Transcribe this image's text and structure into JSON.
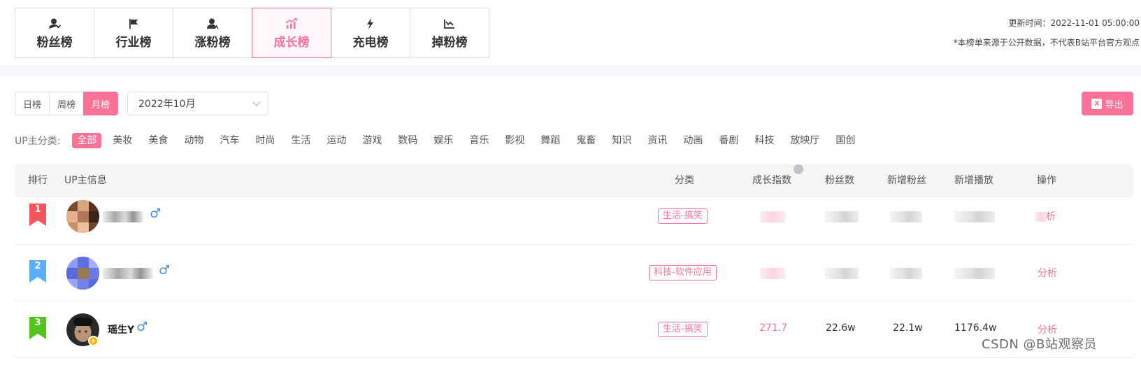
{
  "tabs": [
    {
      "label": "粉丝榜",
      "icon": "fans-icon",
      "active": false
    },
    {
      "label": "行业榜",
      "icon": "flag-icon",
      "active": false
    },
    {
      "label": "涨粉榜",
      "icon": "user-up-icon",
      "active": false
    },
    {
      "label": "成长榜",
      "icon": "growth-chart-icon",
      "active": true
    },
    {
      "label": "充电榜",
      "icon": "lightning-icon",
      "active": false
    },
    {
      "label": "掉粉榜",
      "icon": "down-chart-icon",
      "active": false
    }
  ],
  "header": {
    "update_time": "更新时间：2022-11-01 05:00:00",
    "disclaimer": "*本榜单来源于公开数据，不代表B站平台官方观点"
  },
  "period": {
    "buttons": [
      "日榜",
      "周榜",
      "月榜"
    ],
    "active": "月榜",
    "month_value": "2022年10月"
  },
  "export_label": "导出",
  "categories": {
    "label": "UP主分类:",
    "items": [
      "全部",
      "美妆",
      "美食",
      "动物",
      "汽车",
      "时尚",
      "生活",
      "运动",
      "游戏",
      "数码",
      "娱乐",
      "音乐",
      "影视",
      "舞蹈",
      "鬼畜",
      "知识",
      "资讯",
      "动画",
      "番剧",
      "科技",
      "放映厅",
      "国创"
    ],
    "active": "全部"
  },
  "table": {
    "headers": {
      "rank": "排行",
      "info": "UP主信息",
      "category": "分类",
      "growth": "成长指数",
      "fans": "粉丝数",
      "new_fans": "新增粉丝",
      "new_plays": "新增播放",
      "action": "操作"
    },
    "rows": [
      {
        "rank": "1",
        "rank_color": "#f5555b",
        "name": "",
        "gender": "♂",
        "category": "生活-搞笑",
        "growth": "",
        "fans": "",
        "new_fans": "",
        "new_plays": "",
        "action": "析"
      },
      {
        "rank": "2",
        "rank_color": "#5aaef5",
        "name": "",
        "gender": "♂",
        "category": "科技-软件应用",
        "growth": "",
        "fans": "",
        "new_fans": "",
        "new_plays": "",
        "action": "分析"
      },
      {
        "rank": "3",
        "rank_color": "#52c41a",
        "name": "瑶生Y",
        "gender": "♂",
        "category": "生活-搞笑",
        "growth": "271.7",
        "fans": "22.6w",
        "new_fans": "22.1w",
        "new_plays": "1176.4w",
        "action": "分析"
      }
    ]
  },
  "watermark": "CSDN @B站观察员",
  "colors": {
    "accent": "#fb7299",
    "male": "#4a8de8"
  }
}
